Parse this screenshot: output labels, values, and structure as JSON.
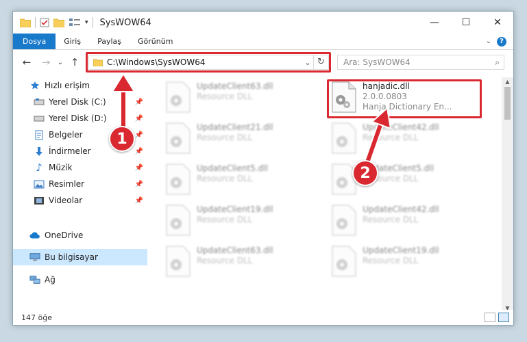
{
  "window": {
    "title": "SysWOW64"
  },
  "window_controls": {
    "minimize": "—",
    "maximize": "☐",
    "close": "✕"
  },
  "ribbon": {
    "tabs": [
      {
        "label": "Dosya",
        "active": true
      },
      {
        "label": "Giriş"
      },
      {
        "label": "Paylaş"
      },
      {
        "label": "Görünüm"
      }
    ],
    "help": "?"
  },
  "navbar": {
    "back": "←",
    "forward": "→",
    "recent": "⌄",
    "up": "↑",
    "address": "C:\\Windows\\SysWOW64",
    "address_dropdown": "⌄",
    "refresh": "↻",
    "search_placeholder": "Ara: SysWOW64",
    "search_icon": "⌕"
  },
  "sidebar": {
    "items": [
      {
        "label": "Hızlı erişim",
        "icon": "star-icon"
      },
      {
        "label": "Yerel Disk (C:)",
        "icon": "drive-icon",
        "pinned": true
      },
      {
        "label": "Yerel Disk (D:)",
        "icon": "drive-icon",
        "pinned": true
      },
      {
        "label": "Belgeler",
        "icon": "documents-icon",
        "pinned": true
      },
      {
        "label": "İndirmeler",
        "icon": "download-icon",
        "pinned": true
      },
      {
        "label": "Müzik",
        "icon": "music-icon",
        "pinned": true
      },
      {
        "label": "Resimler",
        "icon": "pictures-icon",
        "pinned": true
      },
      {
        "label": "Videolar",
        "icon": "videos-icon",
        "pinned": true
      },
      {
        "label": "OneDrive",
        "icon": "cloud-icon"
      },
      {
        "label": "Bu bilgisayar",
        "icon": "computer-icon",
        "selected": true
      },
      {
        "label": "Ağ",
        "icon": "network-icon"
      }
    ],
    "pin_glyph": "📌"
  },
  "files": {
    "left_column": [
      {
        "name": "UpdateClient63.dll",
        "type": "Resource DLL"
      },
      {
        "name": "UpdateClient21.dll",
        "type": "Resource DLL"
      },
      {
        "name": "UpdateClient5.dll",
        "type": "Resource DLL"
      },
      {
        "name": "UpdateClient19.dll",
        "type": "Resource DLL"
      },
      {
        "name": "UpdateClient63.dll",
        "type": "Resource DLL"
      }
    ],
    "right_column": [
      {
        "name": "hanjadic.dll",
        "version": "2.0.0.0803",
        "desc": "Hanja Dictionary En...",
        "focused": true
      },
      {
        "name": "UpdateClient42.dll",
        "type": "Resource DLL"
      },
      {
        "name": "UpdateClient5.dll",
        "type": "Resource DLL"
      },
      {
        "name": "UpdateClient42.dll",
        "type": "Resource DLL"
      },
      {
        "name": "UpdateClient19.dll",
        "type": "Resource DLL"
      }
    ]
  },
  "status": {
    "count": "147 öğe"
  },
  "annotations": [
    {
      "label": "1"
    },
    {
      "label": "2"
    }
  ],
  "colors": {
    "accent": "#1979ca",
    "highlight": "#d9282f",
    "selected": "#cce8ff"
  }
}
